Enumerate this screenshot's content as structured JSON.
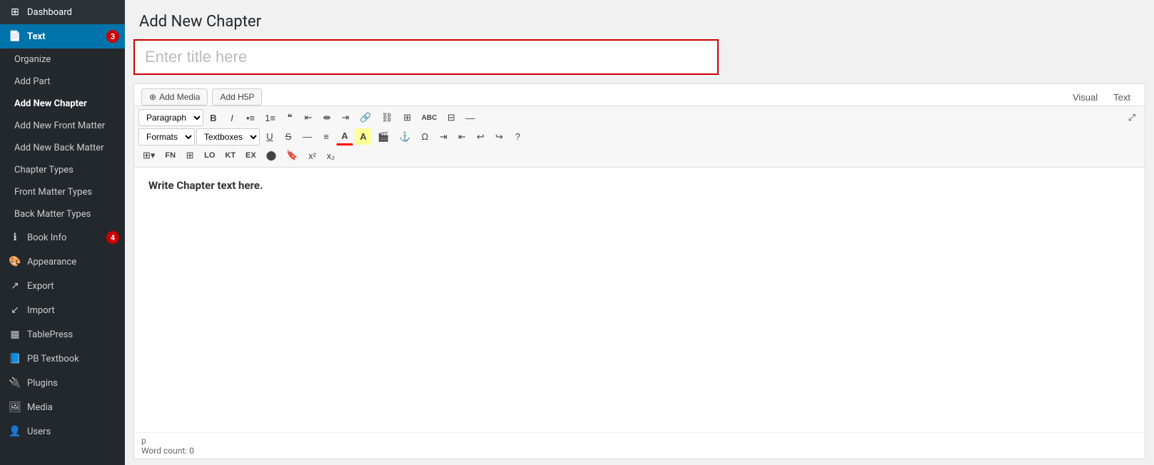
{
  "sidebar": {
    "items": [
      {
        "id": "dashboard",
        "label": "Dashboard",
        "icon": "⊞",
        "active": false,
        "badge": null,
        "sub": false,
        "bold": false
      },
      {
        "id": "text",
        "label": "Text",
        "icon": "📄",
        "active": true,
        "badge": "3",
        "sub": false,
        "bold": true
      },
      {
        "id": "organize",
        "label": "Organize",
        "icon": "",
        "active": false,
        "badge": null,
        "sub": true,
        "bold": false
      },
      {
        "id": "add-part",
        "label": "Add Part",
        "icon": "",
        "active": false,
        "badge": null,
        "sub": true,
        "bold": false
      },
      {
        "id": "add-new-chapter",
        "label": "Add New Chapter",
        "icon": "",
        "active": false,
        "badge": null,
        "sub": true,
        "bold": true
      },
      {
        "id": "add-new-front-matter",
        "label": "Add New Front Matter",
        "icon": "",
        "active": false,
        "badge": null,
        "sub": true,
        "bold": false
      },
      {
        "id": "add-new-back-matter",
        "label": "Add New Back Matter",
        "icon": "",
        "active": false,
        "badge": null,
        "sub": true,
        "bold": false
      },
      {
        "id": "chapter-types",
        "label": "Chapter Types",
        "icon": "",
        "active": false,
        "badge": null,
        "sub": true,
        "bold": false
      },
      {
        "id": "front-matter-types",
        "label": "Front Matter Types",
        "icon": "",
        "active": false,
        "badge": null,
        "sub": true,
        "bold": false
      },
      {
        "id": "back-matter-types",
        "label": "Back Matter Types",
        "icon": "",
        "active": false,
        "badge": null,
        "sub": true,
        "bold": false
      },
      {
        "id": "book-info",
        "label": "Book Info",
        "icon": "ℹ",
        "active": false,
        "badge": "4",
        "sub": false,
        "bold": false
      },
      {
        "id": "appearance",
        "label": "Appearance",
        "icon": "🎨",
        "active": false,
        "badge": null,
        "sub": false,
        "bold": false
      },
      {
        "id": "export",
        "label": "Export",
        "icon": "↗",
        "active": false,
        "badge": null,
        "sub": false,
        "bold": false
      },
      {
        "id": "import",
        "label": "Import",
        "icon": "↙",
        "active": false,
        "badge": null,
        "sub": false,
        "bold": false
      },
      {
        "id": "tablepress",
        "label": "TablePress",
        "icon": "▦",
        "active": false,
        "badge": null,
        "sub": false,
        "bold": false
      },
      {
        "id": "pb-textbook",
        "label": "PB Textbook",
        "icon": "📘",
        "active": false,
        "badge": null,
        "sub": false,
        "bold": false
      },
      {
        "id": "plugins",
        "label": "Plugins",
        "icon": "🔌",
        "active": false,
        "badge": null,
        "sub": false,
        "bold": false
      },
      {
        "id": "media",
        "label": "Media",
        "icon": "🖼",
        "active": false,
        "badge": null,
        "sub": false,
        "bold": false
      },
      {
        "id": "users",
        "label": "Users",
        "icon": "👤",
        "active": false,
        "badge": null,
        "sub": false,
        "bold": false
      }
    ]
  },
  "header": {
    "title": "Add New Chapter"
  },
  "title_input": {
    "placeholder": "Enter title here"
  },
  "media_buttons": [
    {
      "id": "add-media",
      "label": "Add Media",
      "icon": "⊕"
    },
    {
      "id": "add-h5p",
      "label": "Add H5P",
      "icon": ""
    }
  ],
  "view_tabs": [
    {
      "id": "visual",
      "label": "Visual"
    },
    {
      "id": "text",
      "label": "Text"
    }
  ],
  "toolbar": {
    "row1": [
      {
        "id": "paragraph-select",
        "type": "select",
        "value": "Paragraph"
      },
      {
        "id": "bold",
        "label": "B",
        "title": "Bold"
      },
      {
        "id": "italic",
        "label": "I",
        "title": "Italic"
      },
      {
        "id": "ul",
        "label": "≡•",
        "title": "Unordered List"
      },
      {
        "id": "ol",
        "label": "≡1",
        "title": "Ordered List"
      },
      {
        "id": "blockquote",
        "label": "❝",
        "title": "Blockquote"
      },
      {
        "id": "align-left",
        "label": "◧",
        "title": "Align Left"
      },
      {
        "id": "align-center",
        "label": "◫",
        "title": "Align Center"
      },
      {
        "id": "align-right",
        "label": "◨",
        "title": "Align Right"
      },
      {
        "id": "link",
        "label": "🔗",
        "title": "Link"
      },
      {
        "id": "unlink",
        "label": "⛓",
        "title": "Unlink"
      },
      {
        "id": "table-insert",
        "label": "⊞",
        "title": "Insert Table"
      },
      {
        "id": "spell",
        "label": "ABC",
        "title": "Spellcheck"
      },
      {
        "id": "table2",
        "label": "⊟",
        "title": "Table"
      },
      {
        "id": "more",
        "label": "—",
        "title": "More"
      }
    ],
    "row2": [
      {
        "id": "formats-select",
        "type": "select",
        "value": "Formats"
      },
      {
        "id": "textboxes-select",
        "type": "select",
        "value": "Textboxes"
      },
      {
        "id": "underline",
        "label": "U̲",
        "title": "Underline"
      },
      {
        "id": "strikethrough",
        "label": "S̶",
        "title": "Strikethrough"
      },
      {
        "id": "hr",
        "label": "—",
        "title": "Horizontal Rule"
      },
      {
        "id": "align-justify",
        "label": "≡",
        "title": "Justify"
      },
      {
        "id": "font-color",
        "label": "A",
        "title": "Font Color"
      },
      {
        "id": "font-bg",
        "label": "A",
        "title": "Font Background"
      },
      {
        "id": "media-icon",
        "label": "🎬",
        "title": "Media"
      },
      {
        "id": "anchor",
        "label": "⚓",
        "title": "Anchor"
      },
      {
        "id": "special-char",
        "label": "Ω",
        "title": "Special Characters"
      },
      {
        "id": "ltr",
        "label": "⇥",
        "title": "LTR"
      },
      {
        "id": "rtl",
        "label": "⇤",
        "title": "RTL"
      },
      {
        "id": "undo",
        "label": "↩",
        "title": "Undo"
      },
      {
        "id": "redo",
        "label": "↪",
        "title": "Redo"
      },
      {
        "id": "help",
        "label": "?",
        "title": "Help"
      }
    ],
    "row3": [
      {
        "id": "table-tools",
        "label": "⊞▾",
        "title": "Table"
      },
      {
        "id": "fn",
        "label": "FN",
        "title": "Footnote"
      },
      {
        "id": "grid",
        "label": "⊞",
        "title": "Grid"
      },
      {
        "id": "lo",
        "label": "LO",
        "title": "LO"
      },
      {
        "id": "kt",
        "label": "KT",
        "title": "KT"
      },
      {
        "id": "ex",
        "label": "EX",
        "title": "EX"
      },
      {
        "id": "circle",
        "label": "⬤",
        "title": "Circle"
      },
      {
        "id": "bookmark",
        "label": "🔖",
        "title": "Bookmark"
      },
      {
        "id": "superscript",
        "label": "x²",
        "title": "Superscript"
      },
      {
        "id": "subscript",
        "label": "x₂",
        "title": "Subscript"
      }
    ]
  },
  "editor": {
    "content_placeholder": "Write Chapter text here.",
    "footer_tag": "p",
    "word_count_label": "Word count: 0"
  }
}
